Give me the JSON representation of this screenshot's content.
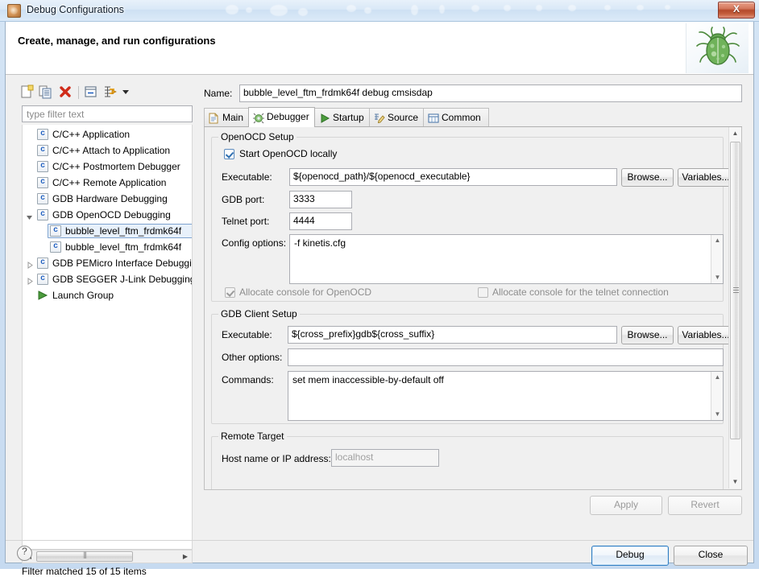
{
  "window": {
    "title": "Debug Configurations",
    "icon": "bug-icon",
    "close_label": "X"
  },
  "banner": {
    "title": "Create, manage, and run configurations",
    "image": "beetle-icon"
  },
  "tree_toolbar": {
    "buttons": [
      {
        "name": "new-configuration-icon",
        "tip": "New launch configuration"
      },
      {
        "name": "duplicate-configuration-icon",
        "tip": "Duplicate"
      },
      {
        "name": "delete-configuration-icon",
        "tip": "Delete"
      },
      {
        "name": "collapse-all-icon",
        "tip": "Collapse All"
      },
      {
        "name": "filter-configurations-icon",
        "tip": "Filter launch configurations"
      },
      {
        "name": "chevron-down-icon",
        "tip": "View menu"
      }
    ]
  },
  "filter": {
    "placeholder": "type filter text",
    "value": "",
    "status": "Filter matched 15 of 15 items"
  },
  "tree": {
    "items": [
      {
        "label": "C/C++ Application",
        "indent": 1,
        "icon": "c-file-icon",
        "twisty": "none",
        "selected": false
      },
      {
        "label": "C/C++ Attach to Application",
        "indent": 1,
        "icon": "c-file-icon",
        "twisty": "none",
        "selected": false
      },
      {
        "label": "C/C++ Postmortem Debugger",
        "indent": 1,
        "icon": "c-file-icon",
        "twisty": "none",
        "selected": false
      },
      {
        "label": "C/C++ Remote Application",
        "indent": 1,
        "icon": "c-file-icon",
        "twisty": "none",
        "selected": false
      },
      {
        "label": "GDB Hardware Debugging",
        "indent": 1,
        "icon": "c-file-icon",
        "twisty": "none",
        "selected": false
      },
      {
        "label": "GDB OpenOCD Debugging",
        "indent": 1,
        "icon": "c-file-icon",
        "twisty": "expanded",
        "selected": false
      },
      {
        "label": "bubble_level_ftm_frdmk64f",
        "indent": 2,
        "icon": "c-file-icon",
        "twisty": "none",
        "selected": true
      },
      {
        "label": "bubble_level_ftm_frdmk64f",
        "indent": 2,
        "icon": "c-file-icon",
        "twisty": "none",
        "selected": false
      },
      {
        "label": "GDB PEMicro Interface Debugging",
        "indent": 1,
        "icon": "c-file-icon",
        "twisty": "collapsed",
        "selected": false
      },
      {
        "label": "GDB SEGGER J-Link Debugging",
        "indent": 1,
        "icon": "c-file-icon",
        "twisty": "collapsed",
        "selected": false
      },
      {
        "label": "Launch Group",
        "indent": 1,
        "icon": "launch-group-icon",
        "twisty": "none",
        "selected": false
      }
    ]
  },
  "config": {
    "name_label": "Name:",
    "name_value": "bubble_level_ftm_frdmk64f debug cmsisdap",
    "tabs": [
      {
        "label": "Main",
        "icon": "page-icon",
        "active": false
      },
      {
        "label": "Debugger",
        "icon": "debugger-icon",
        "active": true
      },
      {
        "label": "Startup",
        "icon": "play-icon",
        "active": false
      },
      {
        "label": "Source",
        "icon": "source-icon",
        "active": false
      },
      {
        "label": "Common",
        "icon": "common-icon",
        "active": false
      }
    ],
    "openocd_group": {
      "title": "OpenOCD Setup",
      "start_locally": {
        "label": "Start OpenOCD locally",
        "checked": true,
        "enabled": true
      },
      "executable_label": "Executable:",
      "executable_value": "${openocd_path}/${openocd_executable}",
      "browse_label": "Browse...",
      "variables_label": "Variables...",
      "gdb_port_label": "GDB port:",
      "gdb_port_value": "3333",
      "telnet_port_label": "Telnet port:",
      "telnet_port_value": "4444",
      "config_options_label": "Config options:",
      "config_options_value": "-f kinetis.cfg",
      "allocate_console_openocd": {
        "label": "Allocate console for OpenOCD",
        "checked": true,
        "enabled": false
      },
      "allocate_console_telnet": {
        "label": "Allocate console for the telnet connection",
        "checked": false,
        "enabled": false
      }
    },
    "gdb_client_group": {
      "title": "GDB Client Setup",
      "executable_label": "Executable:",
      "executable_value": "${cross_prefix}gdb${cross_suffix}",
      "browse_label": "Browse...",
      "variables_label": "Variables...",
      "other_options_label": "Other options:",
      "other_options_value": "",
      "commands_label": "Commands:",
      "commands_value": "set mem inaccessible-by-default off"
    },
    "remote_target_group": {
      "title": "Remote Target",
      "host_label": "Host name or IP address:",
      "host_placeholder": "localhost",
      "host_value": ""
    },
    "apply_label": "Apply",
    "apply_enabled": false,
    "revert_label": "Revert",
    "revert_enabled": false
  },
  "footer": {
    "help_icon": "help-icon",
    "debug_label": "Debug",
    "close_label": "Close"
  },
  "colors": {
    "accent": "#2f7dc2",
    "selection_bg": "#e8f1fb",
    "selection_border": "#7da2ce",
    "dialog_bg": "#f0f0f0",
    "field_bg": "#ffffff",
    "disabled_text": "#8d8d8d",
    "close_button": "#b54a2c"
  }
}
